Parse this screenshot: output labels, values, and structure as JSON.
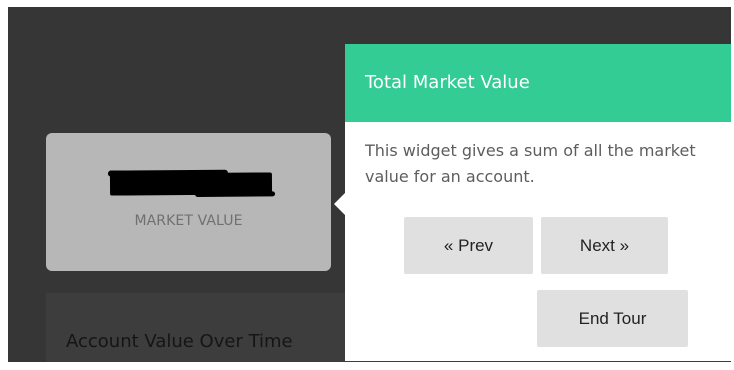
{
  "widget": {
    "caption": "MARKET VALUE"
  },
  "panel": {
    "title": "Account Value Over Time"
  },
  "tour": {
    "title": "Total Market Value",
    "body": "This widget gives a sum of all the market value for an account.",
    "buttons": {
      "prev_label": "« Prev",
      "next_label": "Next »",
      "end_label": "End Tour"
    }
  },
  "colors": {
    "accent": "#33cc95",
    "overlay": "#363636",
    "widget_background": "#b7b7b7",
    "button_background": "#e0e0e0"
  }
}
